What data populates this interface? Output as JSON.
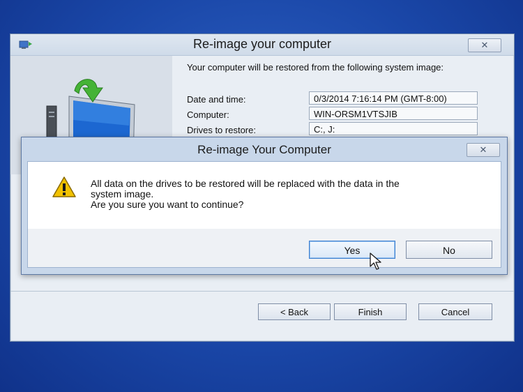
{
  "wizard": {
    "title": "Re-image your computer",
    "intro": "Your computer will be restored from the following system image:",
    "fields": [
      {
        "label": "Date and time:",
        "value": "0/3/2014 7:16:14 PM (GMT-8:00)"
      },
      {
        "label": "Computer:",
        "value": "WIN-ORSM1VTSJIB"
      },
      {
        "label": "Drives to restore:",
        "value": "C:, J:"
      }
    ],
    "buttons": {
      "back": "< Back",
      "finish": "Finish",
      "cancel": "Cancel"
    },
    "close_icon": "close-x"
  },
  "dialog": {
    "title": "Re-image Your Computer",
    "message_line1": "All data on the drives to be restored will be replaced with the data in the",
    "message_line2": "system image.",
    "message_line3": "Are you sure you want to continue?",
    "buttons": {
      "yes": "Yes",
      "no": "No"
    },
    "icon": "warning-icon",
    "close_icon": "close-x"
  },
  "colors": {
    "desktop": "#1a47a8",
    "warning": "#f2c200",
    "accent": "#3c7fd0"
  }
}
